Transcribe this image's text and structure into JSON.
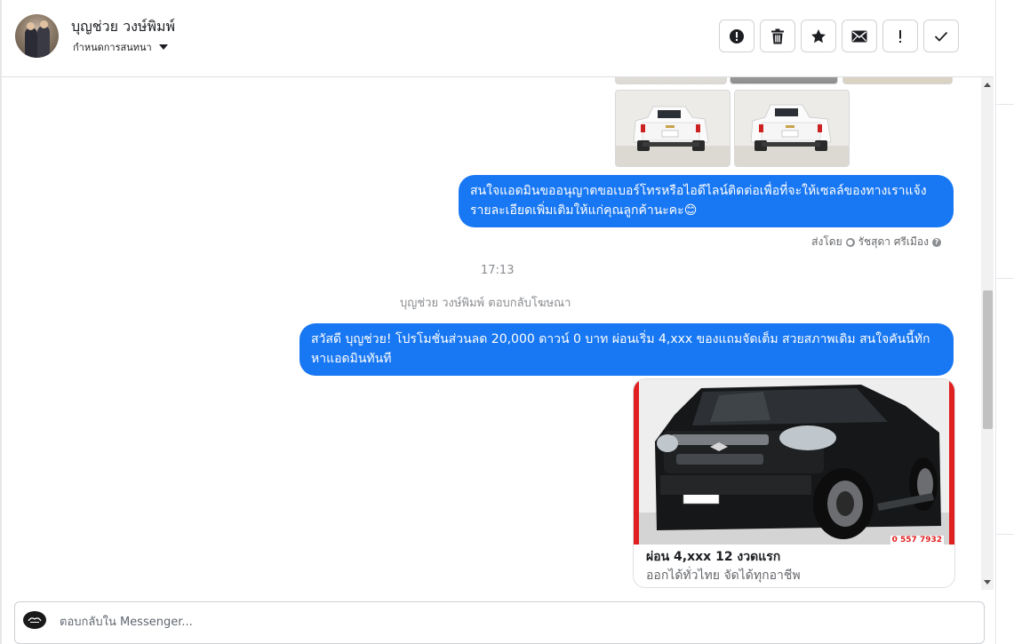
{
  "contact": {
    "name": "บุญช่วย วงษ์พิมพ์",
    "subtitle": "กำหนดการสนทนา"
  },
  "toolbar": {
    "actions": [
      {
        "id": "spam",
        "icon": "alert-circle-icon",
        "tooltip": ""
      },
      {
        "id": "delete",
        "icon": "trash-icon"
      },
      {
        "id": "star",
        "icon": "star-icon"
      },
      {
        "id": "unread",
        "icon": "envelope-icon"
      },
      {
        "id": "follow-up",
        "icon": "exclamation-icon"
      },
      {
        "id": "done",
        "icon": "check-icon"
      }
    ]
  },
  "messages": {
    "bubble1": "สนใจแอดมินขออนุญาตขอเบอร์โทรหรือไอดีไลน์ติดต่อเพื่อที่จะให้เซลล์ของทางเราแจ้งรายละเอียดเพิ่มเติมให้แก่คุณลูกค้านะคะ😊",
    "sent_by_label": "ส่งโดย",
    "sent_by_name": "รัชสุดา ศรีเมือง",
    "time": "17:13",
    "reply_note": "บุญช่วย วงษ์พิมพ์ ตอบกลับโฆษณา",
    "bubble2": "สวัสดี บุญช่วย! โปรโมชั่นส่วนลด 20,000 ดาวน์ 0 บาท ผ่อนเริ่ม 4,xxx  ของแถมจัดเต็ม สวยสภาพเดิม สนใจคันนี้ทักหาแอดมินทันที",
    "ad_card": {
      "title": "ผ่อน 4,xxx 12 งวดแรก",
      "subtitle": "ออกได้ทั่วไทย จัดได้ทุกอาชีพ",
      "overlay_text": "0 557 7932"
    }
  },
  "composer": {
    "placeholder": "ตอบกลับใน Messenger..."
  },
  "colors": {
    "accent": "#1877f2",
    "ad_frame": "#e02020"
  }
}
